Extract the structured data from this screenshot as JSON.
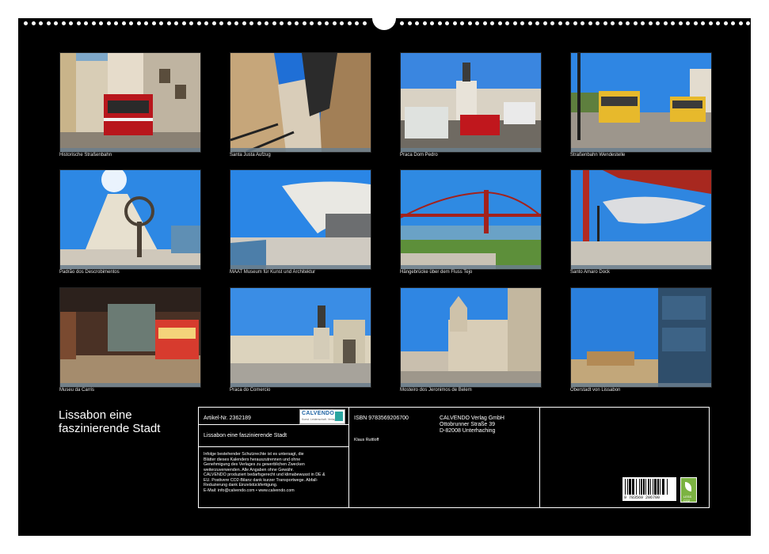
{
  "calendar": {
    "title_line1": "Lissabon eine",
    "title_line2": "faszinierende Stadt"
  },
  "photos": [
    {
      "caption": "Historische Straßenbahn"
    },
    {
      "caption": "Santa Justa Aufzug"
    },
    {
      "caption": "Praca Dom Pedro"
    },
    {
      "caption": "Straßenbahn Wendestelle"
    },
    {
      "caption": "Padrão dos Descrobimentos"
    },
    {
      "caption": "MAAT Museum für Kunst und Architektur"
    },
    {
      "caption": "Hängebrücke über dem Fluss Tejo"
    },
    {
      "caption": "Santo Amaro Dock"
    },
    {
      "caption": "Museu da Carris"
    },
    {
      "caption": "Praca do Comercio"
    },
    {
      "caption": "Mosteiro dos Jeronimos de Belem"
    },
    {
      "caption": "Oberstadt von Lissabon"
    }
  ],
  "info": {
    "article": "Artikel-Nr. 2362189",
    "logo_text": "CALVENDO",
    "logo_sub": "Kunst. Leidenschaft. Verlag",
    "product_title": "Lissabon eine faszinierende Stadt",
    "legal": [
      "Infolge bestehender Schutzrechte ist es untersagt, die",
      "Blätter dieses Kalenders herauszutrennen und ohne",
      "Genehmigung des Verlages zu gewerblichen Zwecken",
      "weiterzuverwenden. Alle Angaben ohne Gewähr.",
      "CALVENDO produziert bedarfsgerecht und klimabewusst in DE &",
      "EU. Postivere CO2-Bilanz dank kurzer Transportwege. Abfall-",
      "Reduzierung dank Einzelstückfertigung.",
      "E-Mail: info@calvendo.com • www.calvendo.com"
    ],
    "isbn": "ISBN 9783569206700",
    "author": "Klaus Ruttloff",
    "publisher_name": "CALVENDO Verlag GmbH",
    "publisher_street": "Ottobrunner Straße 39",
    "publisher_city": "D-82008 Unterhaching",
    "barcode_number": "9 783569 206700",
    "eco_label": "LESS CO2"
  }
}
